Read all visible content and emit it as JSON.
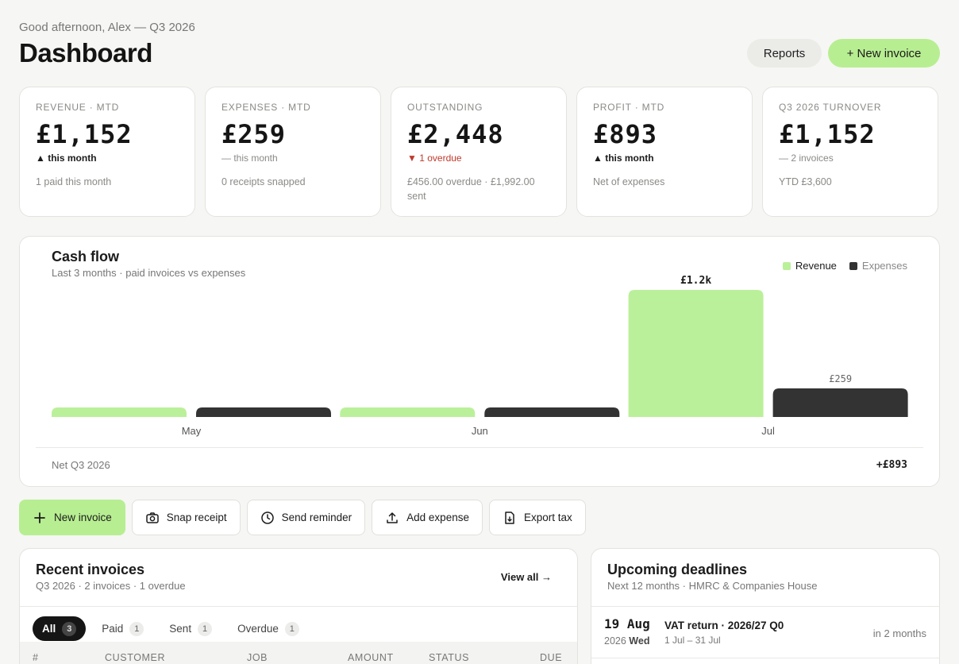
{
  "header": {
    "greeting": "Good afternoon, Alex — Q3 2026",
    "title": "Dashboard",
    "reports_label": "Reports",
    "new_invoice_label": "+ New invoice"
  },
  "kpis": [
    {
      "label": "REVENUE · MTD",
      "value": "£1,152",
      "trend": "▲ this month",
      "trend_kind": "up",
      "note": "1 paid this month"
    },
    {
      "label": "EXPENSES · MTD",
      "value": "£259",
      "trend": "— this month",
      "trend_kind": "flat",
      "note": "0 receipts snapped"
    },
    {
      "label": "OUTSTANDING",
      "value": "£2,448",
      "trend": "▼ 1 overdue",
      "trend_kind": "down",
      "note": "£456.00 overdue · £1,992.00 sent"
    },
    {
      "label": "PROFIT · MTD",
      "value": "£893",
      "trend": "▲ this month",
      "trend_kind": "up",
      "note": "Net of expenses"
    },
    {
      "label": "Q3 2026 TURNOVER",
      "value": "£1,152",
      "trend": "— 2 invoices",
      "trend_kind": "flat",
      "note": "YTD £3,600"
    }
  ],
  "cashflow": {
    "title": "Cash flow",
    "subtitle": "Last 3 months · paid invoices vs expenses",
    "net_label": "Net Q3 2026",
    "net_value": "+£893"
  },
  "chart_data": {
    "type": "bar",
    "categories": [
      "May",
      "Jun",
      "Jul"
    ],
    "series": [
      {
        "name": "Revenue",
        "values": [
          0,
          0,
          1152
        ],
        "color": "#bbf09a"
      },
      {
        "name": "Expenses",
        "values": [
          0,
          0,
          259
        ],
        "color": "#333333"
      }
    ],
    "data_labels": {
      "Jul": {
        "Revenue": "£1.2k",
        "Expenses": "£259"
      }
    },
    "ylim": [
      0,
      1152
    ],
    "legend": "top-right",
    "grid": false
  },
  "actions": [
    {
      "label": "New invoice",
      "icon": "plus-icon",
      "primary": true
    },
    {
      "label": "Snap receipt",
      "icon": "camera-icon",
      "primary": false
    },
    {
      "label": "Send reminder",
      "icon": "clock-icon",
      "primary": false
    },
    {
      "label": "Add expense",
      "icon": "upload-icon",
      "primary": false
    },
    {
      "label": "Export tax",
      "icon": "file-export-icon",
      "primary": false
    }
  ],
  "recent": {
    "title": "Recent invoices",
    "subtitle": "Q3 2026 · 2 invoices · 1 overdue",
    "view_all": "View all →",
    "filters": [
      {
        "label": "All",
        "count": "3",
        "active": true
      },
      {
        "label": "Paid",
        "count": "1",
        "active": false
      },
      {
        "label": "Sent",
        "count": "1",
        "active": false
      },
      {
        "label": "Overdue",
        "count": "1",
        "active": false
      }
    ],
    "columns": [
      "#",
      "CUSTOMER",
      "JOB",
      "AMOUNT",
      "STATUS",
      "DUE"
    ]
  },
  "deadlines": {
    "title": "Upcoming deadlines",
    "subtitle": "Next 12 months · HMRC & Companies House",
    "items": [
      {
        "date": "19 Aug",
        "year": "2026",
        "weekday": "Wed",
        "name": "VAT return · 2026/27 Q0",
        "period": "1 Jul – 31 Jul",
        "due": "in 2 months"
      }
    ]
  }
}
